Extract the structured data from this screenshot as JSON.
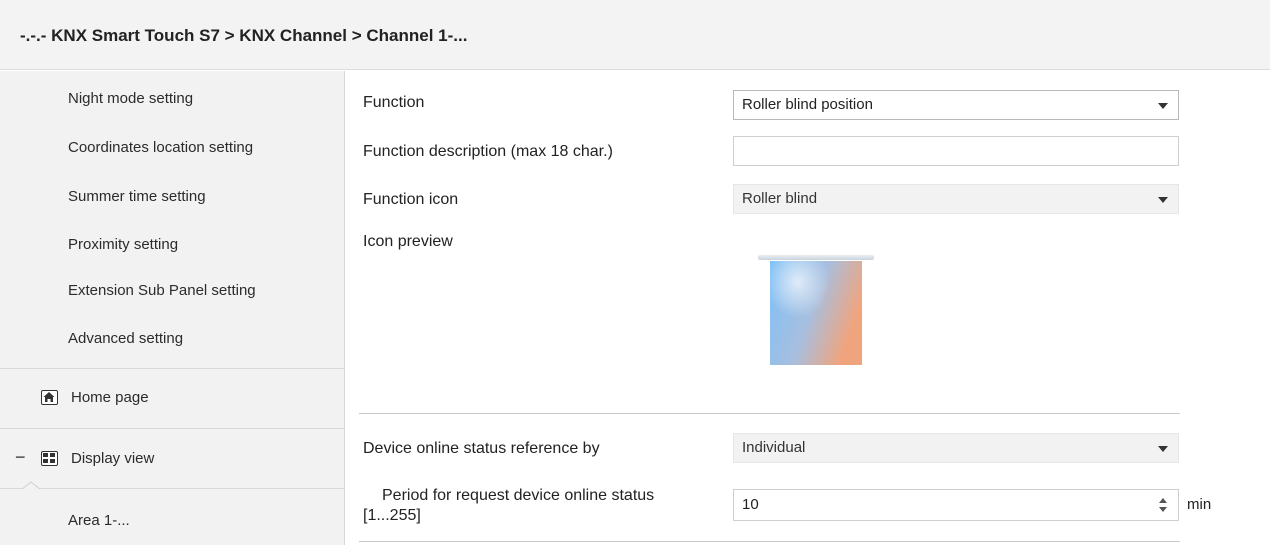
{
  "window": {
    "breadcrumb": "-.-.- KNX Smart Touch S7 > KNX Channel  > Channel 1-..."
  },
  "sidebar": {
    "items": [
      {
        "label": "Night mode setting"
      },
      {
        "label": "Coordinates location setting"
      },
      {
        "label": "Summer time setting"
      },
      {
        "label": "Proximity setting"
      },
      {
        "label": "Extension Sub Panel setting"
      },
      {
        "label": "Advanced setting"
      }
    ],
    "home": {
      "label": "Home page",
      "icon": "home-icon"
    },
    "display": {
      "label": "Display view",
      "icon": "display-grid-icon",
      "toggle": "−"
    },
    "area": {
      "label": "Area 1-..."
    }
  },
  "form": {
    "function": {
      "label": "Function",
      "value": "Roller blind position"
    },
    "description": {
      "label": "Function description (max 18 char.)",
      "value": ""
    },
    "icon": {
      "label": "Function icon",
      "value": "Roller blind"
    },
    "preview": {
      "label": "Icon preview",
      "icon": "roller-blind-icon"
    },
    "online_ref": {
      "label": "Device online status reference by",
      "value": "Individual"
    },
    "period": {
      "label_line1": "Period for request device online status",
      "label_line2": "[1...255]",
      "value": "10",
      "unit": "min"
    }
  },
  "colors": {
    "accent_blue": "#6fb6f3",
    "accent_orange": "#e8a68a",
    "sidebar_bg": "#f2f2f2",
    "titlebar_bg": "#f3f3f3"
  }
}
